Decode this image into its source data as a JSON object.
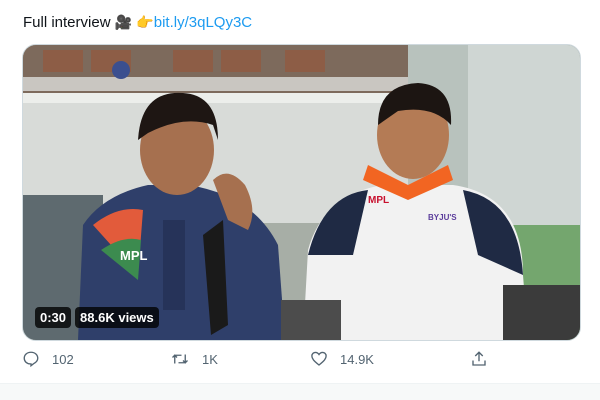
{
  "tweet": {
    "text_prefix": "Full interview",
    "icon_camera": "movie-camera-icon",
    "icon_point": "pointing-hand-icon",
    "link": "bit.ly/3qLQy3C"
  },
  "video": {
    "duration": "0:30",
    "views": "88.6K views",
    "jersey_sponsor": "MPL",
    "jacket_sponsor": "MPL",
    "jacket_brand": "BYJU'S"
  },
  "actions": {
    "reply_count": "102",
    "retweet_count": "1K",
    "like_count": "14.9K",
    "reply_icon": "reply-icon",
    "retweet_icon": "retweet-icon",
    "like_icon": "heart-icon",
    "share_icon": "share-icon"
  },
  "colors": {
    "link": "#1d9bf0",
    "icon_gray": "#536471",
    "border": "#cfd9de"
  }
}
